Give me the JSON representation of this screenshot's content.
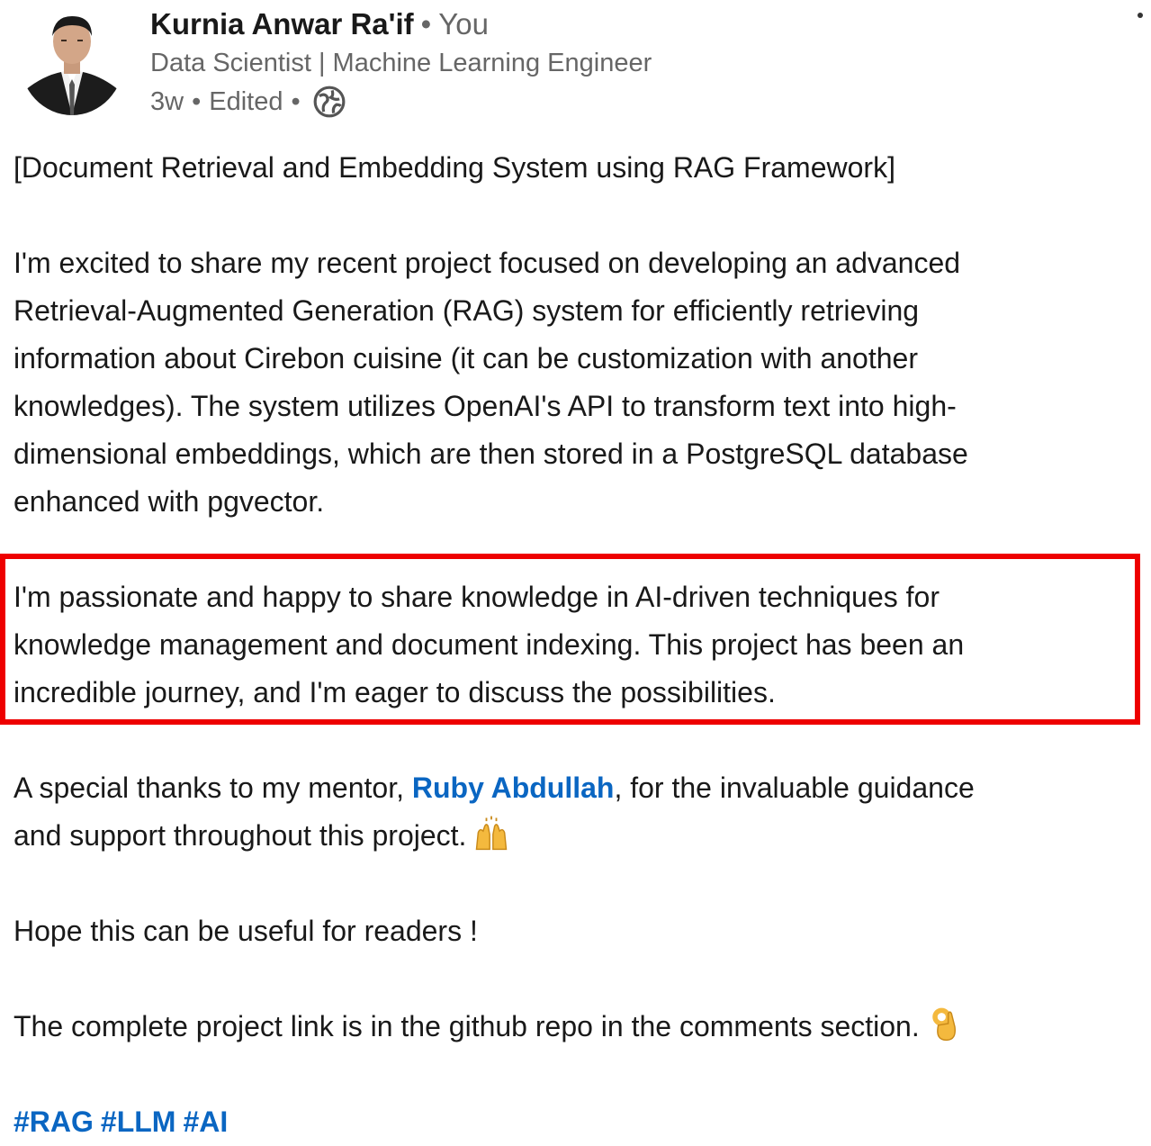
{
  "author": {
    "name": "Kurnia Anwar Ra'if",
    "separator": "•",
    "you_label": "You",
    "headline": "Data Scientist | Machine Learning Engineer",
    "time": "3w",
    "edited": "Edited",
    "visibility_icon": "globe-icon"
  },
  "post": {
    "title": "[Document Retrieval and Embedding System using RAG Framework]",
    "paragraph1_lines": [
      "I'm excited to share my recent project focused on developing an advanced",
      "Retrieval-Augmented Generation (RAG) system for efficiently retrieving",
      "information about Cirebon cuisine (it can be customization with another",
      "knowledges). The system utilizes OpenAI's API to transform text into high-",
      "dimensional embeddings, which are then stored in a PostgreSQL database",
      "enhanced with pgvector."
    ],
    "paragraph2_lines": [
      "I'm passionate and happy to share knowledge in AI-driven techniques for",
      "knowledge management and document indexing. This project has been an",
      "incredible journey, and I'm eager to discuss the possibilities."
    ],
    "thanks_prefix": "A special thanks to my mentor, ",
    "mentor": "Ruby Abdullah",
    "thanks_suffix": ", for the invaluable guidance",
    "thanks_line2": "and support throughout this project.",
    "thanks_emoji": "raising-hands-emoji",
    "hope": "Hope this can be useful for readers !",
    "link_note": "The complete project link is in the github repo in the comments section.",
    "link_emoji": "ok-hand-emoji",
    "hashtags": [
      "#RAG",
      "#LLM",
      "#AI"
    ]
  },
  "colors": {
    "link": "#0a66c2",
    "highlight_border": "#ee0000",
    "meta_text": "#666666"
  }
}
